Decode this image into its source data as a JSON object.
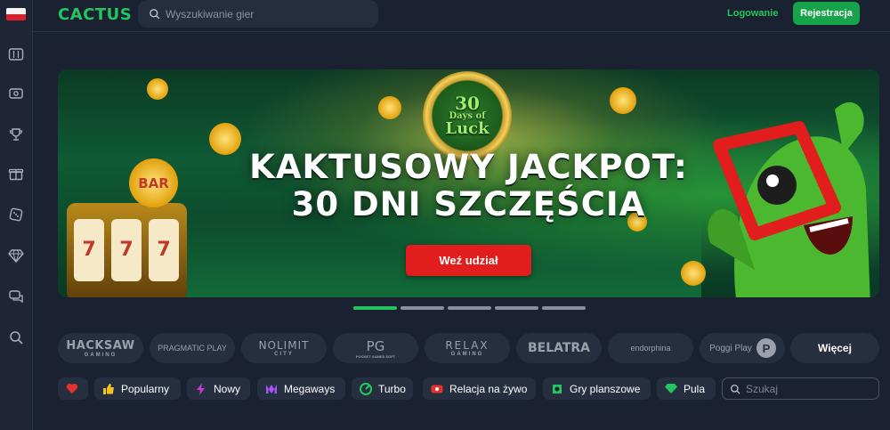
{
  "header": {
    "logo_text": "CACTUS",
    "search_placeholder": "Wyszukiwanie gier",
    "login_label": "Logowanie",
    "register_label": "Rejestracja"
  },
  "sidebar": {
    "language_flag": "pl-flag-icon",
    "items": [
      {
        "icon": "slots-icon"
      },
      {
        "icon": "live-casino-icon"
      },
      {
        "icon": "trophy-icon"
      },
      {
        "icon": "gift-box-icon"
      },
      {
        "icon": "dice-icon"
      },
      {
        "icon": "diamond-icon"
      },
      {
        "icon": "chat-icon"
      },
      {
        "icon": "search-icon"
      }
    ]
  },
  "banner": {
    "medal_line1": "30",
    "medal_line2": "Days of",
    "medal_line3": "Luck",
    "headline_line1": "KAKTUSOWY JACKPOT:",
    "headline_line2": "30 DNI SZCZĘŚCIA",
    "cta_label": "Weź udział",
    "slot_symbols": [
      "7",
      "7",
      "7"
    ],
    "bar_text": "BAR",
    "active_slide": 1,
    "slide_count": 5
  },
  "providers": [
    {
      "name": "HACKSAW",
      "sub": "GAMING"
    },
    {
      "name": "PRAGMATIC PLAY",
      "sub": ""
    },
    {
      "name": "NOLIMIT",
      "sub": "CITY"
    },
    {
      "name": "PG",
      "sub": "POCKET GAMES SOFT"
    },
    {
      "name": "RELAX",
      "sub": "GAMING"
    },
    {
      "name": "BELATRA",
      "sub": ""
    },
    {
      "name": "endorphina",
      "sub": ""
    },
    {
      "name": "Poggi Play",
      "sub": ""
    }
  ],
  "providers_more_label": "Więcej",
  "categories": [
    {
      "label": "",
      "icon": "heart-icon"
    },
    {
      "label": "Popularny",
      "icon": "thumbs-up-icon"
    },
    {
      "label": "Nowy",
      "icon": "lightning-icon"
    },
    {
      "label": "Megaways",
      "icon": "megaways-icon"
    },
    {
      "label": "Turbo",
      "icon": "turbo-icon"
    },
    {
      "label": "Relacja na żywo",
      "icon": "live-camera-icon"
    },
    {
      "label": "Gry planszowe",
      "icon": "board-game-icon"
    },
    {
      "label": "Pula",
      "icon": "diamond-icon"
    }
  ],
  "category_search_placeholder": "Szukaj",
  "colors": {
    "accent": "#22c55e",
    "background": "#1a2130",
    "cta": "#e11d1d"
  }
}
